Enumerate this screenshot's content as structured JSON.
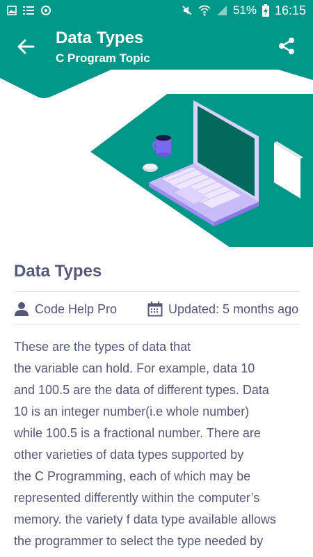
{
  "status_bar": {
    "battery_text": "51%",
    "time": "16:15",
    "icons": [
      "gallery-icon",
      "list-icon",
      "sync-icon",
      "mute-icon",
      "wifi-icon",
      "signal-icon",
      "battery-charging-icon"
    ]
  },
  "app_bar": {
    "title": "Data Types",
    "subtitle": "C Program Topic",
    "back_icon": "arrow-back-icon",
    "share_icon": "share-icon"
  },
  "hero": {
    "illustration": "laptop-with-coffee-mug-and-mouse",
    "accent_color": "#009688",
    "laptop_color": "#9e8cf0"
  },
  "article": {
    "title": "Data Types",
    "author": "Code Help Pro",
    "updated": "Updated: 5 months ago",
    "body_lines": [
      "These are the types of data that",
      "the variable can hold. For example, data 10",
      "and 100.5 are the data of different types. Data",
      "10 is an integer number(i.e whole number)",
      "while 100.5 is a fractional number. There are",
      "other varieties of data types supported by",
      "the C Programming, each of which may be",
      "represented differently within the computer’s",
      "memory. the variety f data type available allows",
      "the programmer to select the type needed by"
    ]
  },
  "colors": {
    "primary": "#009688",
    "text": "#555877",
    "divider": "#e2e2e2"
  }
}
